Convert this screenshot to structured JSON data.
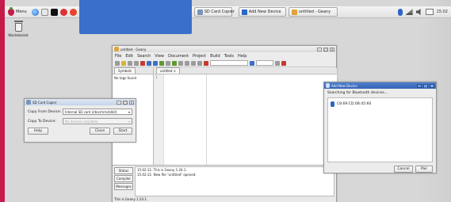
{
  "taskbar": {
    "menu_label": "Menu",
    "tasks": [
      {
        "label": "SD Card Copier",
        "icon": "sd-card-icon"
      },
      {
        "label": "Add New Device",
        "icon": "bluetooth-icon"
      },
      {
        "label": "untitled - Geany",
        "icon": "geany-icon"
      }
    ],
    "clock": "15:02"
  },
  "desktop": {
    "wastebasket_label": "Wastebasket"
  },
  "geany": {
    "title": "untitled - Geany",
    "menu": [
      "File",
      "Edit",
      "Search",
      "View",
      "Document",
      "Project",
      "Build",
      "Tools",
      "Help"
    ],
    "sidebar_tab": "Symbols",
    "sidebar_message": "No tags found",
    "doc_tab": "untitled",
    "line_number": "1",
    "message_tabs": [
      "Status",
      "Compiler",
      "Messages"
    ],
    "log_lines": [
      "15:02:11: This is Geany 1.24.1.",
      "15:02:11: New file \"untitled\" opened."
    ],
    "status_bar": "This is Geany 1.24.1."
  },
  "sd_copier": {
    "title": "SD Card Copier",
    "copy_from_label": "Copy From Device:",
    "copy_from_value": "Internal SD card (/dev/mmcblk0)",
    "copy_to_label": "Copy To Device:",
    "copy_to_value": "No devices available",
    "help_label": "Help",
    "close_label": "Close",
    "start_label": "Start"
  },
  "bluetooth": {
    "title": "Add New Device",
    "status": "Searching for Bluetooth devices...",
    "device_mac": "C8:69:CD:0B:45:60",
    "cancel_label": "Cancel",
    "pair_label": "Pair"
  },
  "colors": {
    "accent_red": "#c51b4a",
    "bt_titlebar": "#3563b3"
  }
}
